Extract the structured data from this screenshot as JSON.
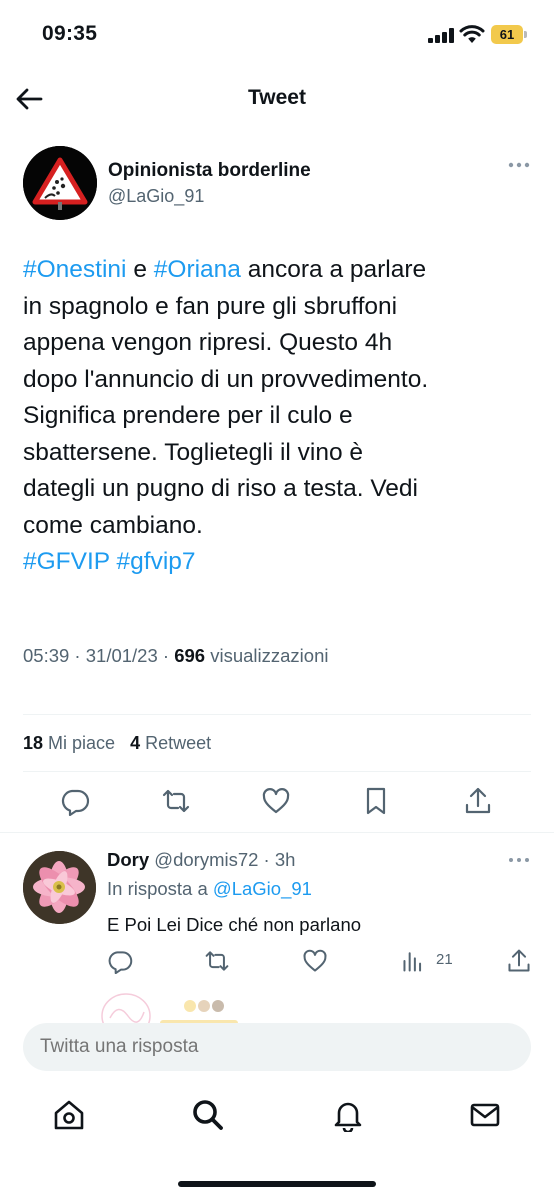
{
  "status_bar": {
    "time": "09:35",
    "battery_percent": "61"
  },
  "nav": {
    "title": "Tweet"
  },
  "tweet": {
    "author_name": "Opinionista borderline",
    "author_handle": "@LaGio_91",
    "text": {
      "line1_tag1": "#Onestini",
      "line1_mid": " e ",
      "line1_tag2": "#Oriana",
      "line1_rest": " ancora a parlare",
      "line2": "in spagnolo e fan pure gli sbruffoni",
      "line3": "appena vengon ripresi. Questo 4h",
      "line4": "dopo l'annuncio di un provvedimento.",
      "line5": "Significa prendere per il culo e",
      "line6": "sbattersene. Toglietegli il vino è",
      "line7": "dategli un pugno di riso a testa. Vedi",
      "line8": "come cambiano.",
      "tag3": "#GFVIP",
      "tag4": "#gfvip7"
    },
    "time": "05:39",
    "date": "31/01/23",
    "views_count": "696",
    "views_label": "visualizzazioni",
    "likes_count": "18",
    "likes_label": "Mi piace",
    "retweets_count": "4",
    "retweets_label": "Retweet"
  },
  "reply": {
    "name": "Dory",
    "handle": "@dorymis72",
    "age": "3h",
    "in_reply_to_label": "In risposta a",
    "in_reply_to_handle": "@LaGio_91",
    "text": "E Poi Lei Dice ché non parlano",
    "views_count": "21"
  },
  "compose": {
    "placeholder": "Twitta una risposta"
  },
  "colors": {
    "accent": "#1d9bf0",
    "text": "#0f1419",
    "secondary": "#536471",
    "battery": "#f2c94c"
  }
}
